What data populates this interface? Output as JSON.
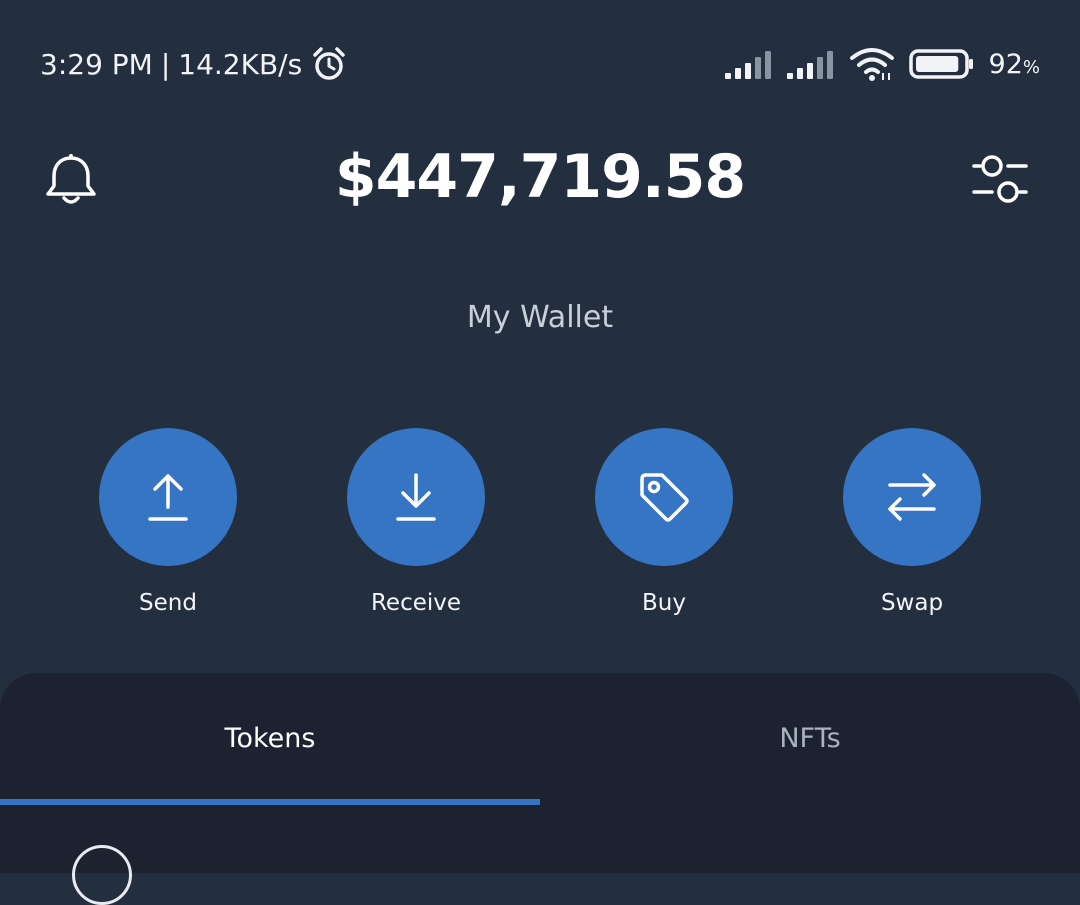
{
  "status_bar": {
    "time": "3:29 PM",
    "separator": "|",
    "speed": "14.2KB/s",
    "battery_percent": "92",
    "battery_unit": "%",
    "battery_level": 0.92,
    "icons": [
      "alarm-clock-icon",
      "signal-icon",
      "signal-icon",
      "wifi-icon",
      "battery-icon"
    ]
  },
  "header": {
    "balance": "$447,719.58",
    "left_icon": "bell-icon",
    "right_icon": "sliders-icon"
  },
  "wallet": {
    "name": "My Wallet"
  },
  "actions": [
    {
      "label": "Send",
      "icon": "upload-arrow-icon"
    },
    {
      "label": "Receive",
      "icon": "download-arrow-icon"
    },
    {
      "label": "Buy",
      "icon": "price-tag-icon"
    },
    {
      "label": "Swap",
      "icon": "swap-arrows-icon"
    }
  ],
  "tabs": {
    "items": [
      {
        "label": "Tokens",
        "active": true
      },
      {
        "label": "NFTs",
        "active": false
      }
    ]
  },
  "colors": {
    "background": "#232e3e",
    "panel": "#1c2230",
    "accent": "#3575c3",
    "muted_text": "#aab2bf"
  }
}
